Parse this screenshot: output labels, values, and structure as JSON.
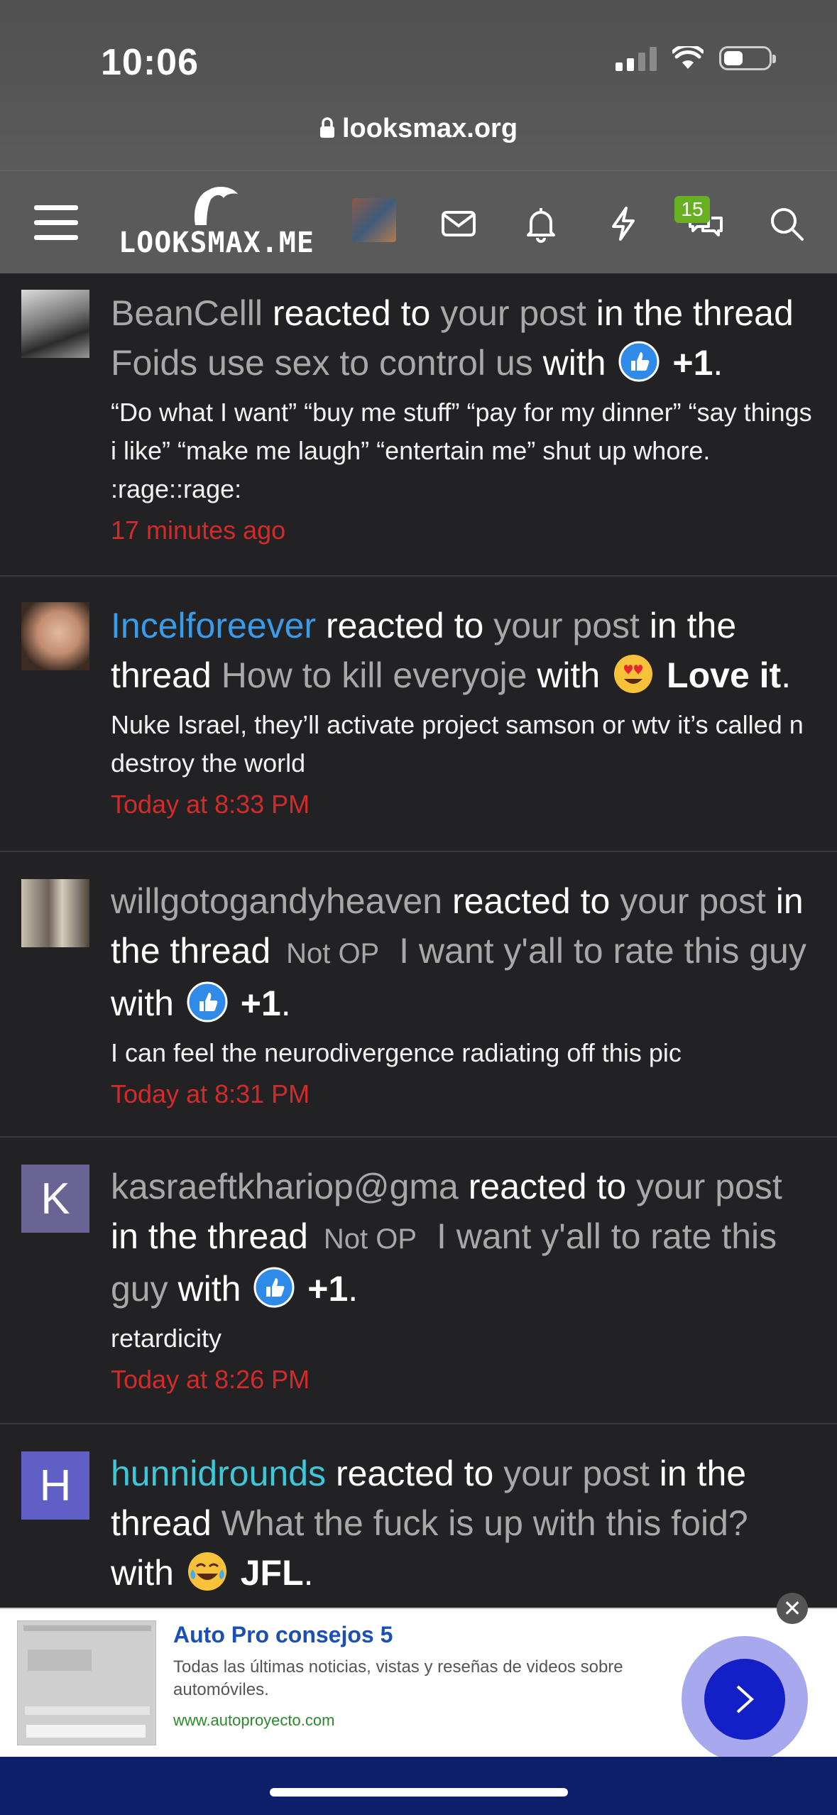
{
  "status_bar": {
    "time": "10:06"
  },
  "browser": {
    "url": "looksmax.org"
  },
  "navbar": {
    "logo_text": "LOOKSMAX.ME",
    "conversations_badge": "15"
  },
  "notifications": [
    {
      "user": "BeanCelll",
      "action": "reacted to",
      "post_link": "your post",
      "in_thread": "in the thread",
      "prefix": "",
      "thread": "Foids use sex to control us",
      "with": "with",
      "reaction": "+1",
      "reaction_icon": "like-icon",
      "snippet": "“Do what I want” “buy me stuff” “pay for my dinner” “say things i like” “make me laugh” “entertain me” shut up whore. :rage::rage:",
      "time": "17 minutes ago"
    },
    {
      "user": "Incelforeever",
      "action": "reacted to",
      "post_link": "your post",
      "in_thread": "in the thread",
      "prefix": "",
      "thread": "How to kill everyoje",
      "with": "with",
      "reaction": "Love it",
      "reaction_icon": "heart-eyes-icon",
      "snippet": "Nuke Israel, they’ll activate project samson or wtv it’s called n destroy the world",
      "time": "Today at 8:33 PM"
    },
    {
      "user": "willgotogandyheaven",
      "action": "reacted to",
      "post_link": "your post",
      "in_thread": "in the thread",
      "prefix": "Not OP",
      "thread": "I want y'all to rate this guy",
      "with": "with",
      "reaction": "+1",
      "reaction_icon": "like-icon",
      "snippet": "I can feel the neurodivergence radiating off this pic",
      "time": "Today at 8:31 PM"
    },
    {
      "user": "kasraeftkhariop@gma",
      "avatar_letter": "K",
      "action": "reacted to",
      "post_link": "your post",
      "in_thread": "in the thread",
      "prefix": "Not OP",
      "thread": "I want y'all to rate this guy",
      "with": "with",
      "reaction": "+1",
      "reaction_icon": "like-icon",
      "snippet": "retardicity",
      "time": "Today at 8:26 PM"
    },
    {
      "user": "hunnidrounds",
      "avatar_letter": "H",
      "action": "reacted to",
      "post_link": "your post",
      "in_thread": "in the thread",
      "prefix": "",
      "thread": "What the fuck is up with this foid?",
      "with": "with",
      "reaction": "JFL",
      "reaction_icon": "tears-of-joy-icon"
    }
  ],
  "ad": {
    "title": "Auto Pro consejos 5",
    "description": "Todas las últimas noticias, vistas y reseñas de videos sobre automóviles.",
    "url": "www.autoproyecto.com",
    "close": "✕"
  },
  "colors": {
    "background": "#222225",
    "navbar": "#5a5a5a",
    "time_red": "#d32a2a",
    "link_blue": "#3a9be8",
    "badge_green": "#67b021"
  }
}
